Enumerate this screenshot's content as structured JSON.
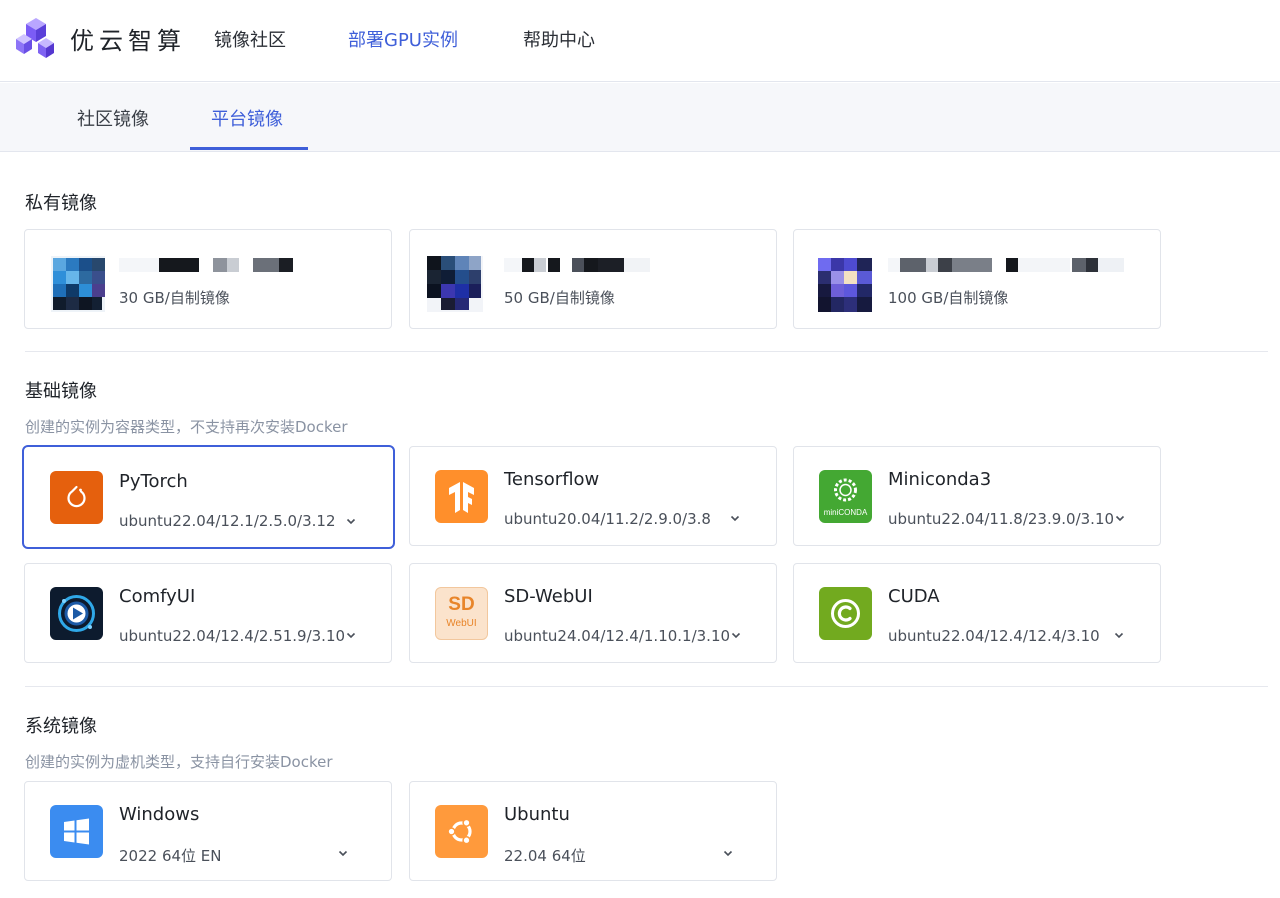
{
  "brand": {
    "name": "优云智算"
  },
  "nav": [
    {
      "label": "镜像社区",
      "active": false
    },
    {
      "label": "部署GPU实例",
      "active": true
    },
    {
      "label": "帮助中心",
      "active": false
    }
  ],
  "tabs": [
    {
      "label": "社区镜像",
      "active": false
    },
    {
      "label": "平台镜像",
      "active": true
    }
  ],
  "private": {
    "title": "私有镜像",
    "cards": [
      {
        "sub": "30 GB/自制镜像"
      },
      {
        "sub": "50 GB/自制镜像"
      },
      {
        "sub": "100 GB/自制镜像"
      }
    ]
  },
  "base": {
    "title": "基础镜像",
    "desc": "创建的实例为容器类型，不支持再次安装Docker",
    "cards": [
      {
        "name": "PyTorch",
        "version": "ubuntu22.04/12.1/2.5.0/3.12",
        "icon": "pytorch-icon",
        "color": "#e5600d",
        "selected": true
      },
      {
        "name": "Tensorflow",
        "version": "ubuntu20.04/11.2/2.9.0/3.8",
        "icon": "tensorflow-icon",
        "color": "#ff8f2b",
        "selected": false
      },
      {
        "name": "Miniconda3",
        "version": "ubuntu22.04/11.8/23.9.0/3.10",
        "icon": "miniconda-icon",
        "color": "#44a833",
        "badge": "miniCONDA",
        "selected": false
      },
      {
        "name": "ComfyUI",
        "version": "ubuntu22.04/12.4/2.51.9/3.10",
        "icon": "comfyui-icon",
        "color": "#0d1b2e",
        "selected": false
      },
      {
        "name": "SD-WebUI",
        "version": "ubuntu24.04/12.4/1.10.1/3.10",
        "icon": "sd-webui-icon",
        "color": "#fbe3cc",
        "badge_main": "SD",
        "badge_sub": "WebUI",
        "selected": false
      },
      {
        "name": "CUDA",
        "version": "ubuntu22.04/12.4/12.4/3.10",
        "icon": "cuda-icon",
        "color": "#72aa1f",
        "selected": false
      }
    ]
  },
  "system": {
    "title": "系统镜像",
    "desc": "创建的实例为虚机类型，支持自行安装Docker",
    "cards": [
      {
        "name": "Windows",
        "version": "2022 64位 EN",
        "icon": "windows-icon",
        "color": "#3b8cf0"
      },
      {
        "name": "Ubuntu",
        "version": "22.04 64位",
        "icon": "ubuntu-icon",
        "color": "#ff9a3c"
      }
    ]
  }
}
